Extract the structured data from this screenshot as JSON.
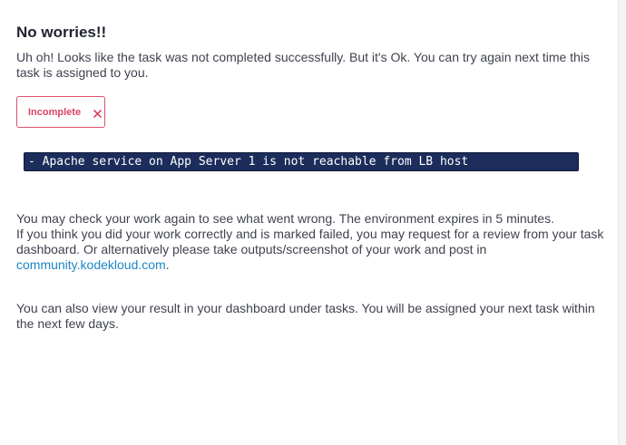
{
  "heading": "No worries!!",
  "intro": "Uh oh! Looks like the task was not completed successfully. But it's Ok. You can try again next time this task is assigned to you.",
  "status_badge": {
    "label": "Incomplete",
    "icon": "close-icon",
    "color": "#d9435f"
  },
  "error_message": "- Apache service on App Server 1 is not reachable from LB host",
  "check_info": {
    "line1": "You may check your work again to see what went wrong. The environment expires in 5 minutes.",
    "line2": "If you think you did your work correctly and is marked failed, you may request for a review from your task dashboard. Or alternatively please take outputs/screenshot of your work and post in",
    "link_text": "community.kodekloud.com",
    "link_suffix": "."
  },
  "dashboard_info": "You can also view your result in your dashboard under tasks. You will be assigned your next task within the next few days.",
  "colors": {
    "error_bar_bg": "#1c2d5c",
    "link": "#1d86c4",
    "badge_border": "#e0506f"
  }
}
